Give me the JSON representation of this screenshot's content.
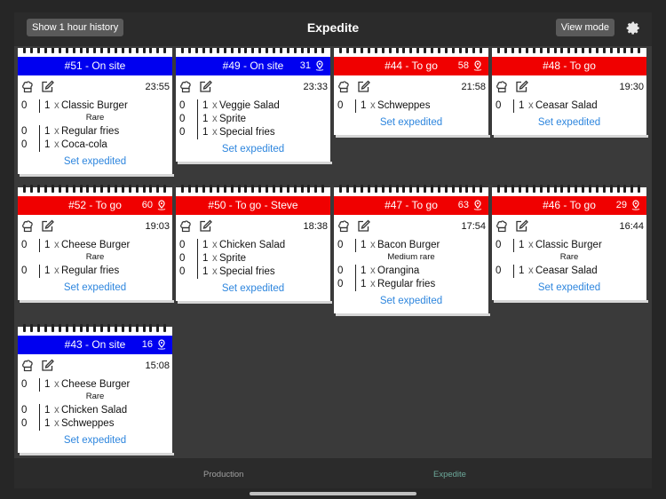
{
  "header": {
    "title": "Expedite",
    "history_label": "Show 1 hour history",
    "view_mode_label": "View mode"
  },
  "colors": {
    "onsite": "#0000f0",
    "togo": "#f00000",
    "link": "#2e86de"
  },
  "set_expedited_label": "Set expedited",
  "orders": [
    {
      "title": "#51 - On site",
      "type": "onsite",
      "badge": "",
      "time": "23:55",
      "items": [
        {
          "done": "0",
          "qty": "1",
          "name": "Classic Burger",
          "mod": "Rare"
        },
        {
          "done": "0",
          "qty": "1",
          "name": "Regular fries"
        },
        {
          "done": "0",
          "qty": "1",
          "name": "Coca-cola"
        }
      ]
    },
    {
      "title": "#49 - On site",
      "type": "onsite",
      "badge": "31",
      "time": "23:33",
      "items": [
        {
          "done": "0",
          "qty": "1",
          "name": "Veggie Salad"
        },
        {
          "done": "0",
          "qty": "1",
          "name": "Sprite"
        },
        {
          "done": "0",
          "qty": "1",
          "name": "Special fries"
        }
      ]
    },
    {
      "title": "#44 - To go",
      "type": "togo",
      "badge": "58",
      "time": "21:58",
      "items": [
        {
          "done": "0",
          "qty": "1",
          "name": "Schweppes"
        }
      ]
    },
    {
      "title": "#48 - To go",
      "type": "togo",
      "badge": "",
      "time": "19:30",
      "items": [
        {
          "done": "0",
          "qty": "1",
          "name": "Ceasar Salad"
        }
      ]
    },
    {
      "title": "#52 - To go",
      "type": "togo",
      "badge": "60",
      "time": "19:03",
      "items": [
        {
          "done": "0",
          "qty": "1",
          "name": "Cheese Burger",
          "mod": "Rare"
        },
        {
          "done": "0",
          "qty": "1",
          "name": "Regular fries"
        }
      ]
    },
    {
      "title": "#50 - To go - Steve",
      "type": "togo",
      "badge": "",
      "time": "18:38",
      "items": [
        {
          "done": "0",
          "qty": "1",
          "name": "Chicken Salad"
        },
        {
          "done": "0",
          "qty": "1",
          "name": "Sprite"
        },
        {
          "done": "0",
          "qty": "1",
          "name": "Special fries"
        }
      ]
    },
    {
      "title": "#47 - To go",
      "type": "togo",
      "badge": "63",
      "time": "17:54",
      "items": [
        {
          "done": "0",
          "qty": "1",
          "name": "Bacon Burger",
          "mod": "Medium rare"
        },
        {
          "done": "0",
          "qty": "1",
          "name": "Orangina"
        },
        {
          "done": "0",
          "qty": "1",
          "name": "Regular fries"
        }
      ]
    },
    {
      "title": "#46 - To go",
      "type": "togo",
      "badge": "29",
      "time": "16:44",
      "items": [
        {
          "done": "0",
          "qty": "1",
          "name": "Classic Burger",
          "mod": "Rare"
        },
        {
          "done": "0",
          "qty": "1",
          "name": "Ceasar Salad"
        }
      ]
    },
    {
      "title": "#43 - On site",
      "type": "onsite",
      "badge": "16",
      "time": "15:08",
      "items": [
        {
          "done": "0",
          "qty": "1",
          "name": "Cheese Burger",
          "mod": "Rare"
        },
        {
          "done": "0",
          "qty": "1",
          "name": "Chicken Salad"
        },
        {
          "done": "0",
          "qty": "1",
          "name": "Schweppes"
        }
      ]
    }
  ],
  "tabs": {
    "production": "Production",
    "expedite": "Expedite"
  }
}
